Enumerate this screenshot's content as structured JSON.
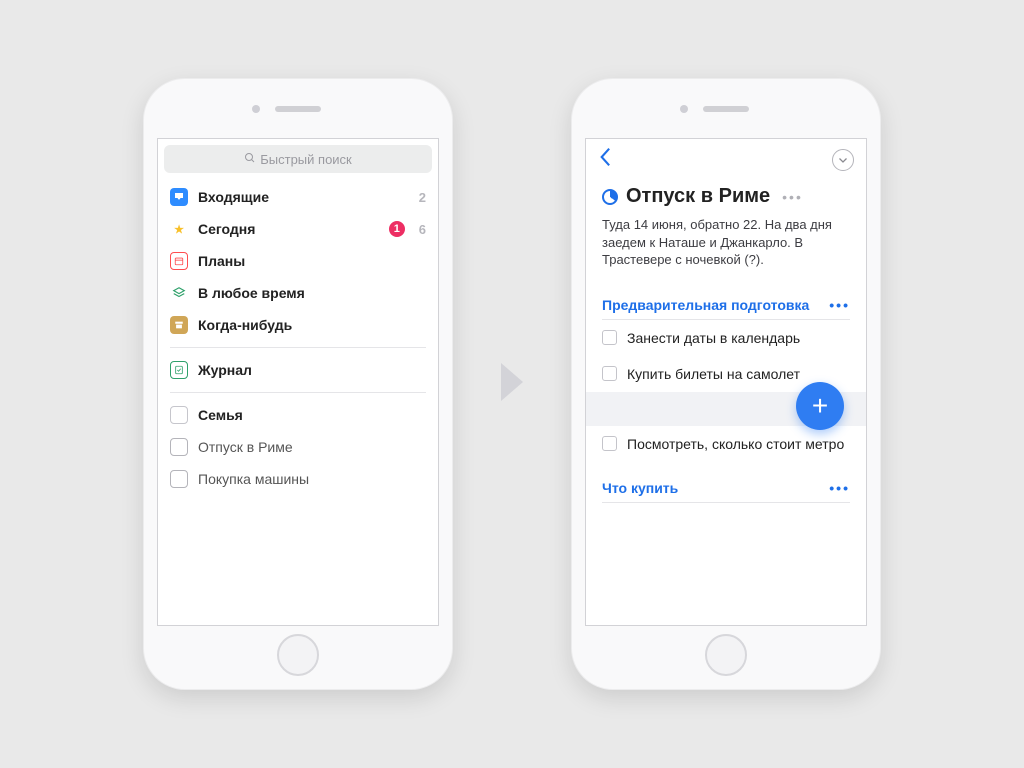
{
  "left": {
    "search_placeholder": "Быстрый поиск",
    "items": [
      {
        "label": "Входящие",
        "count": "2"
      },
      {
        "label": "Сегодня",
        "badge": "1",
        "count": "6"
      },
      {
        "label": "Планы"
      },
      {
        "label": "В любое время"
      },
      {
        "label": "Когда-нибудь"
      }
    ],
    "logbook": {
      "label": "Журнал"
    },
    "area": {
      "label": "Семья"
    },
    "projects": [
      {
        "label": "Отпуск в Риме"
      },
      {
        "label": "Покупка машины"
      }
    ]
  },
  "right": {
    "title": "Отпуск в Риме",
    "notes": "Туда 14 июня, обратно 22. На два дня заедем к Наташе и Джанкарло. В Трастевере с ночевкой (?).",
    "sections": [
      {
        "title": "Предварительная подготовка",
        "tasks": [
          "Занести даты в календарь",
          "Купить билеты на самолет",
          "Посмотреть, сколько стоит метро"
        ]
      },
      {
        "title": "Что купить",
        "tasks": []
      }
    ]
  }
}
